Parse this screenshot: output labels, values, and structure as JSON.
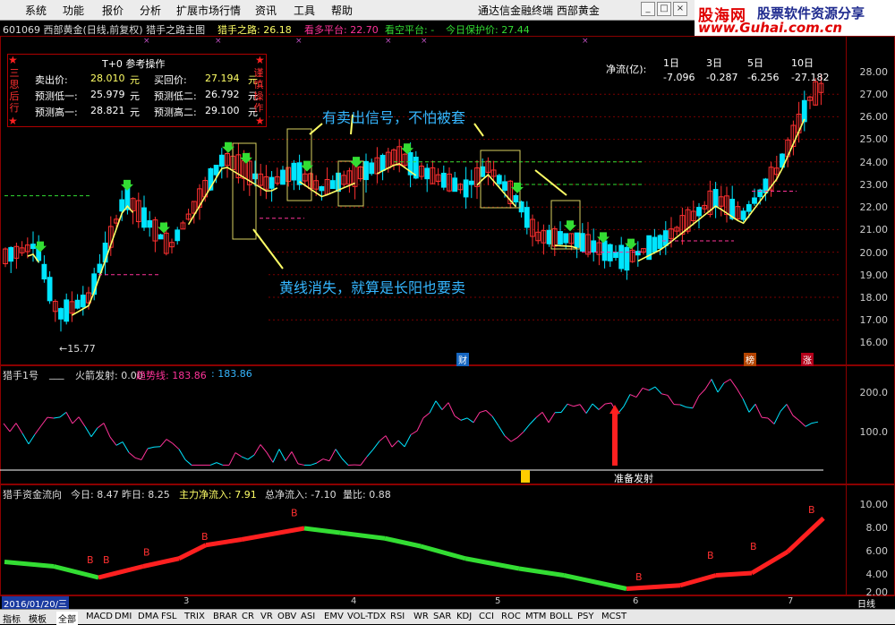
{
  "menu": [
    "系统",
    "功能",
    "报价",
    "分析",
    "扩展市场行情",
    "资讯",
    "工具",
    "帮助"
  ],
  "brand_text": "通达信金融终端   西部黄金",
  "window_buttons": [
    "_",
    "□",
    "×"
  ],
  "logo": {
    "name": "股海网",
    "slogan": "股票软件资源分享",
    "url": "www.Guhai.com.cn"
  },
  "title": {
    "stock": "601069 西部黄金(日线,前复权) 猎手之路主图",
    "hunter_label": "猎手之路: 26.18",
    "bull_label": "看多平台: 22.70",
    "bear_label": "看空平台: -",
    "protect_label": "今日保护价: 27.44"
  },
  "info_box": {
    "title": "T+0 参考操作",
    "left_vertical": "三思后行",
    "right_vertical": "谨慎操作",
    "rows": [
      {
        "k1": "卖出价:",
        "v1": "28.010",
        "u1": "元",
        "k2": "买回价:",
        "v2": "27.194",
        "u2": "元"
      },
      {
        "k1": "预测低一:",
        "v1": "25.979",
        "u1": "元",
        "k2": "预测低二:",
        "v2": "26.792",
        "u2": "元"
      },
      {
        "k1": "预测高一:",
        "v1": "28.821",
        "u1": "元",
        "k2": "预测高二:",
        "v2": "29.100",
        "u2": "元"
      }
    ]
  },
  "net_flow": {
    "label": "净流(亿):",
    "headers": [
      "1日",
      "3日",
      "5日",
      "10日"
    ],
    "values": [
      "-7.096",
      "-0.287",
      "-6.256",
      "-27.182"
    ]
  },
  "annotations": {
    "sell_signal": "有卖出信号，不怕被套",
    "yellow_line": "黄线消失，就算是长阳也要卖"
  },
  "low_marker": "←15.77",
  "event_tags": [
    "财",
    "榜",
    "涨"
  ],
  "colors": {
    "up": "#ff3030",
    "down": "#00e5ff",
    "line": "#ffff66",
    "green": "#33dd33",
    "magenta": "#ff3399"
  },
  "price_axis": [
    "28.00",
    "27.00",
    "26.00",
    "25.00",
    "24.00",
    "23.00",
    "22.00",
    "21.00",
    "20.00",
    "19.00",
    "18.00",
    "17.00",
    "16.00"
  ],
  "indicator1": {
    "name": "猎手1号",
    "fire_label": "火箭发射: 0.00",
    "trend_label": "趋势线: 183.86",
    "trend_value2": ": 183.86",
    "ready_label": "准备发射",
    "axis": [
      "200.0",
      "100.0"
    ]
  },
  "indicator2": {
    "name": "猎手资金流向",
    "today": "今日: 8.47",
    "yesterday": "昨日: 8.25",
    "main_in": "主力净流入: 7.91",
    "total_in": "总净流入: -7.10",
    "ratio": "量比: 0.88",
    "axis": [
      "10.00",
      "8.00",
      "6.00",
      "4.00",
      "2.00"
    ],
    "marker": "B"
  },
  "date_bar": {
    "date": "2016/01/20/三",
    "months": [
      "2",
      "3",
      "4",
      "5",
      "6",
      "7"
    ],
    "period": "日线"
  },
  "tabs": [
    "指标",
    "模板",
    "全部",
    "MACD",
    "DMI",
    "DMA",
    "FSL",
    "TRIX",
    "BRAR",
    "CR",
    "VR",
    "OBV",
    "ASI",
    "EMV",
    "VOL-TDX",
    "RSI",
    "WR",
    "SAR",
    "KDJ",
    "CCI",
    "ROC",
    "MTM",
    "BOLL",
    "PSY",
    "MCST"
  ]
}
